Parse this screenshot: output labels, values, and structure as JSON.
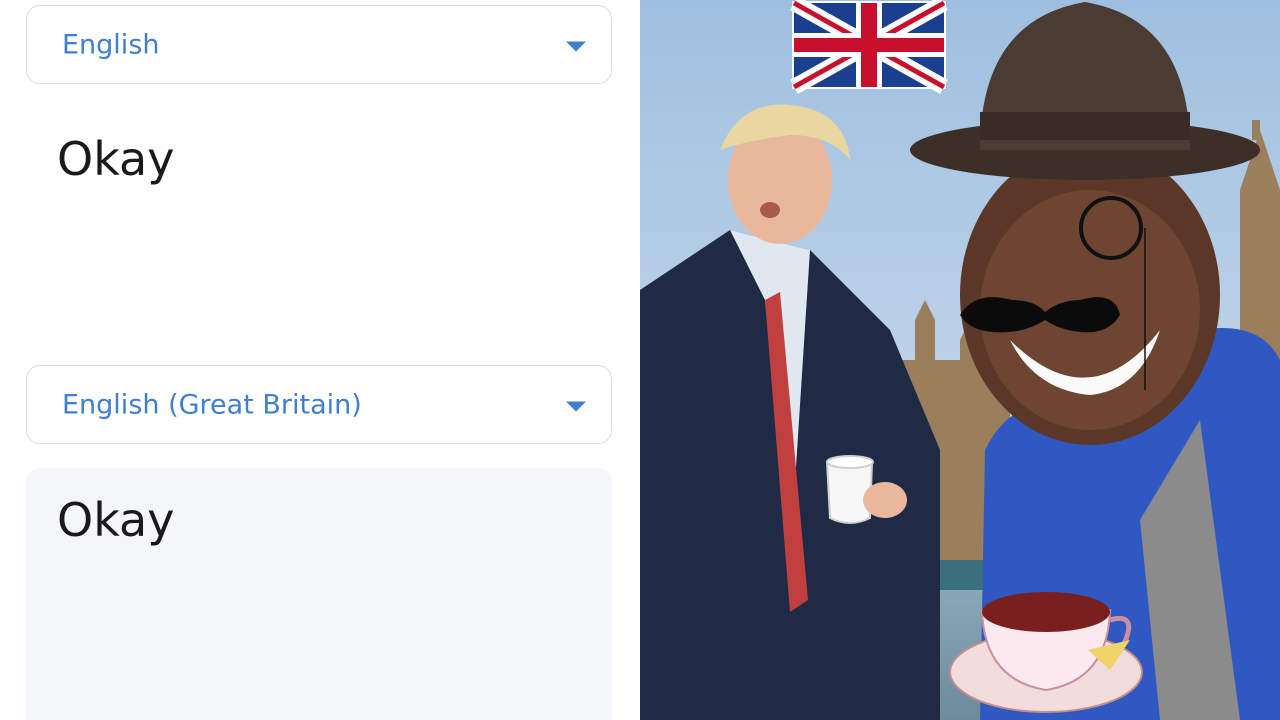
{
  "translator": {
    "source_language": "English",
    "source_text": "Okay",
    "target_language": "English (Great Britain)",
    "translated_text": "Okay",
    "dropdown_icon": "triangle-down-icon",
    "accent_color": "#3f7fcf"
  },
  "meme_image": {
    "elements": [
      "union-jack-flag",
      "man-in-suit-with-teacup",
      "smiling-man-in-bowler-hat",
      "monocle",
      "moustache",
      "teacup-with-saucer",
      "parliament-building"
    ]
  }
}
